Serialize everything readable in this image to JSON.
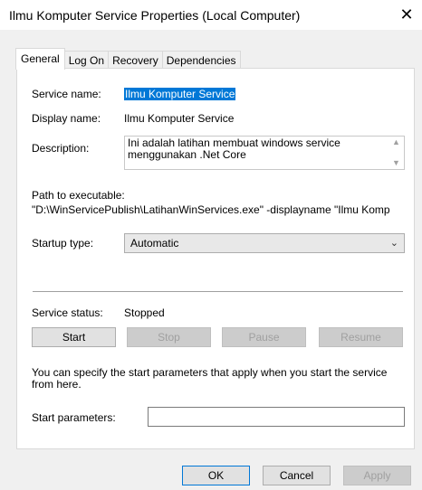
{
  "window": {
    "title": "Ilmu Komputer Service Properties (Local Computer)",
    "close_label": "✕"
  },
  "tabs": [
    {
      "label": "General",
      "active": true
    },
    {
      "label": "Log On",
      "active": false
    },
    {
      "label": "Recovery",
      "active": false
    },
    {
      "label": "Dependencies",
      "active": false
    }
  ],
  "general": {
    "service_name_label": "Service name:",
    "service_name_value": "Ilmu Komputer Service",
    "display_name_label": "Display name:",
    "display_name_value": "Ilmu Komputer Service",
    "description_label": "Description:",
    "description_value": "Ini adalah latihan membuat windows service menggunakan .Net Core",
    "path_label": "Path to executable:",
    "path_value": "\"D:\\WinServicePublish\\LatihanWinServices.exe\"  -displayname \"Ilmu Komp",
    "startup_type_label": "Startup type:",
    "startup_type_value": "Automatic",
    "service_status_label": "Service status:",
    "service_status_value": "Stopped",
    "buttons": {
      "start": "Start",
      "stop": "Stop",
      "pause": "Pause",
      "resume": "Resume"
    },
    "start_params_note": "You can specify the start parameters that apply when you start the service from here.",
    "start_params_label": "Start parameters:",
    "start_params_value": ""
  },
  "footer": {
    "ok": "OK",
    "cancel": "Cancel",
    "apply": "Apply"
  }
}
